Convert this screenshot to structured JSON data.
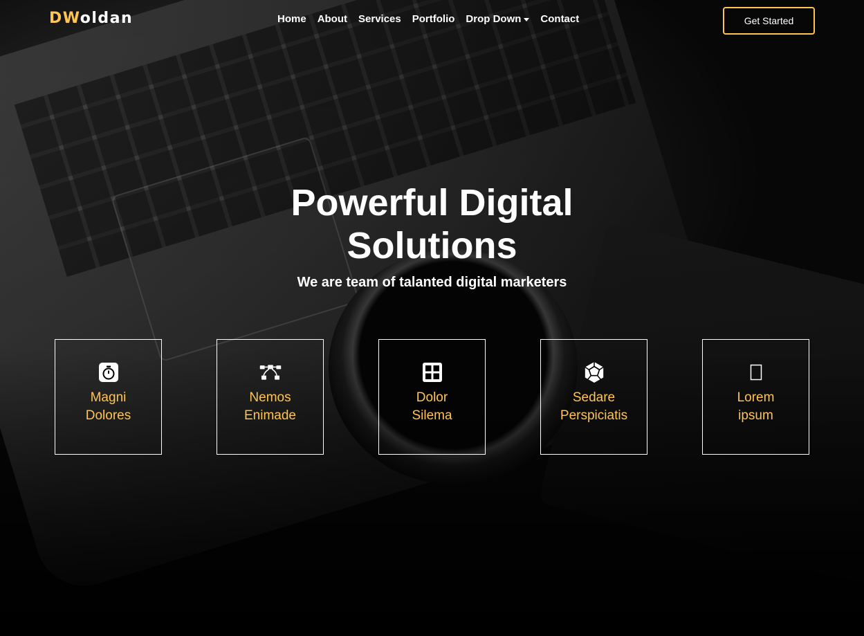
{
  "brand": {
    "logo_accent": "DW",
    "logo_rest": "oldan",
    "accent_color": "#ffc451"
  },
  "nav": {
    "items": [
      {
        "label": "Home"
      },
      {
        "label": "About"
      },
      {
        "label": "Services"
      },
      {
        "label": "Portfolio"
      },
      {
        "label": "Drop Down",
        "has_dropdown": true
      },
      {
        "label": "Contact"
      }
    ],
    "cta_label": "Get Started"
  },
  "hero": {
    "title_line1": "Powerful Digital",
    "title_line2": "Solutions",
    "subtitle": "We are team of talanted digital marketers"
  },
  "features": [
    {
      "icon": "stopwatch-icon",
      "line1": "Magni",
      "line2": "Dolores"
    },
    {
      "icon": "bezier-curve-icon",
      "line1": "Nemos",
      "line2": "Enimade"
    },
    {
      "icon": "grid-icon",
      "line1": "Dolor",
      "line2": "Silema"
    },
    {
      "icon": "dodecahedron-icon",
      "line1": "Sedare",
      "line2": "Perspiciatis"
    },
    {
      "icon": "missing-glyph-icon",
      "line1": "Lorem",
      "line2": "ipsum"
    }
  ]
}
